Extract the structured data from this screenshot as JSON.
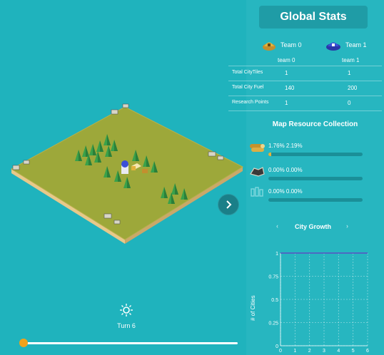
{
  "panel": {
    "title": "Global Stats",
    "teams": [
      {
        "name": "Team 0",
        "sub": "team 0",
        "color": "#e2b23c"
      },
      {
        "name": "Team 1",
        "sub": "team 1",
        "color": "#3b4fd8"
      }
    ],
    "stats": [
      {
        "label": "Total CityTiles",
        "team0": "1",
        "team1": "1"
      },
      {
        "label": "Total City Fuel",
        "team0": "140",
        "team1": "200"
      },
      {
        "label": "Research Points",
        "team0": "1",
        "team1": "0"
      }
    ]
  },
  "resources": {
    "title": "Map Resource Collection",
    "items": [
      {
        "name": "wood",
        "text": "1.76% 2.19%",
        "fill": 0.03,
        "icon": "wood-icon"
      },
      {
        "name": "coal",
        "text": "0.00% 0.00%",
        "fill": 0.0,
        "icon": "coal-icon"
      },
      {
        "name": "uranium",
        "text": "0.00% 0.00%",
        "fill": 0.0,
        "icon": "uranium-icon"
      }
    ]
  },
  "growth": {
    "title": "City Growth",
    "prev": "‹",
    "next": "›"
  },
  "chart_data": {
    "type": "line",
    "title": "City Growth",
    "xlabel": "",
    "ylabel": "# of Cities",
    "ylim": [
      0,
      1
    ],
    "yticks": [
      "1",
      "0.75",
      "0.5",
      "0.25",
      "0"
    ],
    "xticks": [
      "0",
      "1",
      "2",
      "3",
      "4",
      "5",
      "6"
    ],
    "grid": true,
    "series": [
      {
        "values": [
          1,
          1,
          1,
          1,
          1,
          1,
          1
        ],
        "color": "#3b4fd8"
      },
      {
        "values": [
          1,
          1,
          1,
          1,
          1,
          1,
          1
        ],
        "color": "#e2b23c"
      }
    ]
  },
  "game": {
    "turn_label": "Turn 6",
    "turn": 6,
    "max_turn": 360,
    "next_icon": "chevron-right-icon",
    "turn_icon": "sun-icon"
  }
}
